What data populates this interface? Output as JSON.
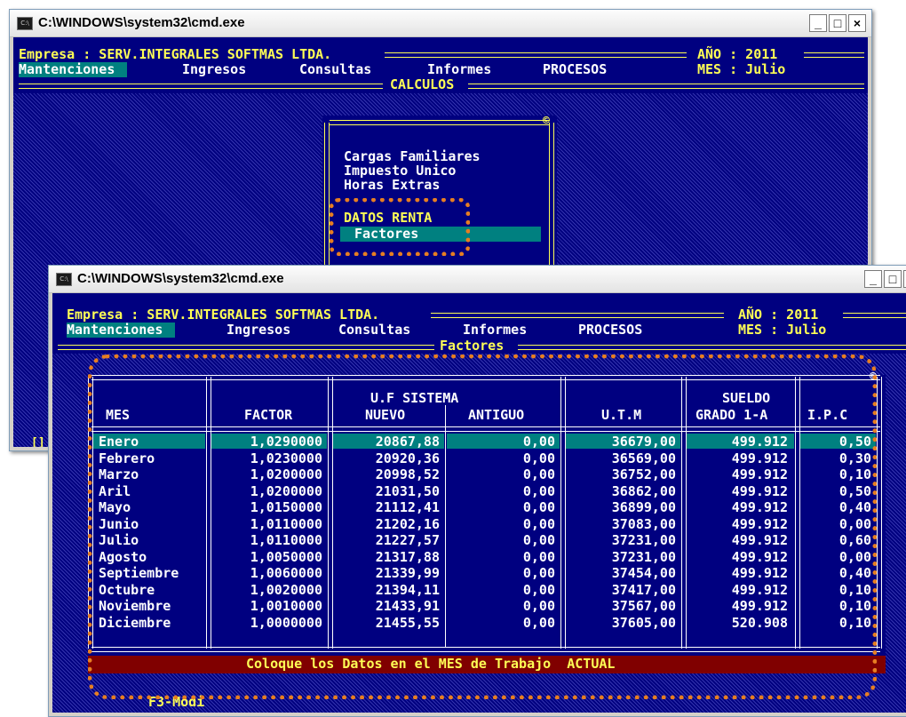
{
  "back_window": {
    "title": "C:\\WINDOWS\\system32\\cmd.exe",
    "header_left": "Empresa : SERV.INTEGRALES SOFTMAS LTDA.",
    "year_line": "AÑO : 2011",
    "month_line": "MES : Julio",
    "menu": [
      "Mantenciones",
      "Ingresos",
      "Consultas",
      "Informes",
      "PROCESOS"
    ],
    "section": "CALCULOS",
    "corner_mark": "©",
    "submenu": [
      "Cargas Familiares",
      "Impuesto Unico",
      "Horas Extras",
      "DATOS RENTA",
      "Factores"
    ],
    "status_fragment": "[]"
  },
  "front_window": {
    "title": "C:\\WINDOWS\\system32\\cmd.exe",
    "header_left": "Empresa : SERV.INTEGRALES SOFTMAS LTDA.",
    "year_line": "AÑO : 2011",
    "month_line": "MES : Julio",
    "menu": [
      "Mantenciones",
      "Ingresos",
      "Consultas",
      "Informes",
      "PROCESOS"
    ],
    "section": "Factores",
    "corner_mark": "©",
    "table": {
      "group_header": "U.F SISTEMA",
      "columns": [
        "MES",
        "FACTOR",
        "NUEVO",
        "ANTIGUO",
        "U.T.M",
        "SUELDO",
        "GRADO 1-A",
        "I.P.C"
      ],
      "rows": [
        [
          "Enero",
          "1,0290000",
          "20867,88",
          "0,00",
          "36679,00",
          "499.912",
          "0,50"
        ],
        [
          "Febrero",
          "1,0230000",
          "20920,36",
          "0,00",
          "36569,00",
          "499.912",
          "0,30"
        ],
        [
          "Marzo",
          "1,0200000",
          "20998,52",
          "0,00",
          "36752,00",
          "499.912",
          "0,10"
        ],
        [
          "Aril",
          "1,0200000",
          "21031,50",
          "0,00",
          "36862,00",
          "499.912",
          "0,50"
        ],
        [
          "Mayo",
          "1,0150000",
          "21112,41",
          "0,00",
          "36899,00",
          "499.912",
          "0,40"
        ],
        [
          "Junio",
          "1,0110000",
          "21202,16",
          "0,00",
          "37083,00",
          "499.912",
          "0,00"
        ],
        [
          "Julio",
          "1,0110000",
          "21227,57",
          "0,00",
          "37231,00",
          "499.912",
          "0,60"
        ],
        [
          "Agosto",
          "1,0050000",
          "21317,88",
          "0,00",
          "37231,00",
          "499.912",
          "0,00"
        ],
        [
          "Septiembre",
          "1,0060000",
          "21339,99",
          "0,00",
          "37454,00",
          "499.912",
          "0,40"
        ],
        [
          "Octubre",
          "1,0020000",
          "21394,11",
          "0,00",
          "37417,00",
          "499.912",
          "0,10"
        ],
        [
          "Noviembre",
          "1,0010000",
          "21433,91",
          "0,00",
          "37567,00",
          "499.912",
          "0,10"
        ],
        [
          "Diciembre",
          "1,0000000",
          "21455,55",
          "0,00",
          "37605,00",
          "520.908",
          "0,10"
        ]
      ]
    },
    "status": "Coloque los Datos en el MES de Trabajo  ACTUAL",
    "hotkey": "F3-Modi"
  },
  "colors": {
    "console_bg": "#000080",
    "highlight": "#008080",
    "status_bar": "#800000",
    "annotation": "#e67e22"
  }
}
